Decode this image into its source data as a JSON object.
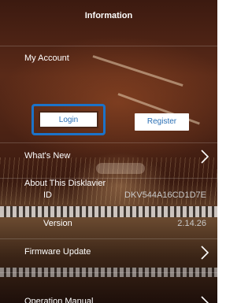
{
  "header": {
    "title": "Information"
  },
  "account": {
    "section_label": "My Account",
    "login_label": "Login",
    "register_label": "Register"
  },
  "menu": {
    "whats_new": "What's New",
    "about": "About This Disklavier",
    "id_label": "ID",
    "id_value": "DKV544A16CD1D7E",
    "version_label": "Version",
    "version_value": "2.14.26",
    "firmware_update": "Firmware Update",
    "operation_manual": "Operation Manual"
  },
  "colors": {
    "accent_blue": "#1c73c9",
    "button_text": "#2a6fb5"
  }
}
